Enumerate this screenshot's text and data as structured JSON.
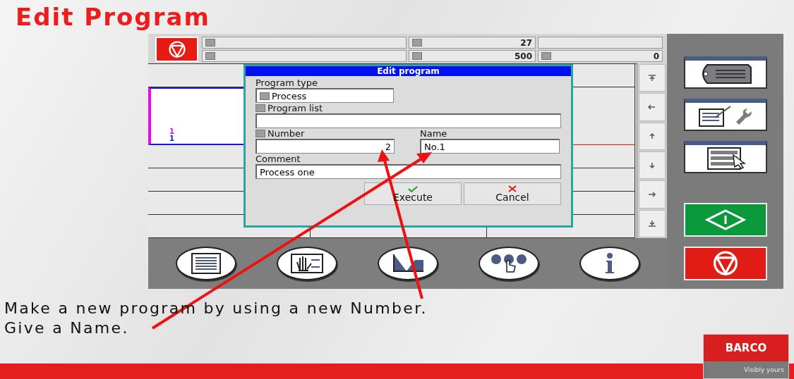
{
  "title": "Edit Program",
  "header": {
    "readings": [
      "27",
      "500",
      "0"
    ]
  },
  "trend_labels": [
    {
      "text": "1",
      "color": "#e010e0"
    },
    {
      "text": "1",
      "color": "#2020c8"
    }
  ],
  "dialog": {
    "title": "Edit program",
    "program_type": {
      "label": "Program type",
      "value": "Process"
    },
    "program_list": {
      "label": "Program list"
    },
    "number": {
      "label": "Number",
      "value": "2"
    },
    "name": {
      "label": "Name",
      "value": "No.1"
    },
    "comment": {
      "label": "Comment",
      "value": "Process one"
    },
    "buttons": [
      {
        "label": "Execute",
        "kind": "ok"
      },
      {
        "label": "Cancel",
        "kind": "cancel"
      }
    ]
  },
  "caption": [
    "Make a new program by using a new Number.",
    "Give a Name."
  ],
  "logo": {
    "brand": "BARCO",
    "tagline": "Visibly yours"
  }
}
